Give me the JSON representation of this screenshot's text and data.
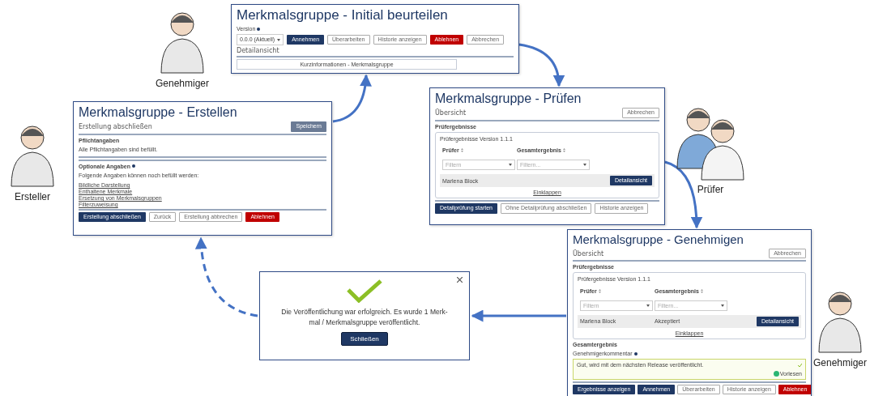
{
  "roles": [
    {
      "kind": "single",
      "label": "Genehmiger"
    },
    {
      "kind": "single",
      "label": "Ersteller"
    },
    {
      "kind": "pair",
      "label": "Prüfer"
    },
    {
      "kind": "single",
      "label": "Genehmiger"
    }
  ],
  "initial_panel": {
    "title": "Merkmalsgruppe - Initial beurteilen",
    "version_label": "Version",
    "version_value": "0.0.0 (Aktuell)",
    "buttons": [
      {
        "label": "Annehmen",
        "kind": "primary"
      },
      {
        "label": "Überarbeiten",
        "kind": "secondary"
      },
      {
        "label": "Historie anzeigen",
        "kind": "secondary"
      },
      {
        "label": "Ablehnen",
        "kind": "danger"
      },
      {
        "label": "Abbrechen",
        "kind": "secondary"
      }
    ],
    "section": "Detailansicht",
    "card_title": "Kurzinformationen - Merkmalsgruppe"
  },
  "create_panel": {
    "title": "Merkmalsgruppe - Erstellen",
    "subtitle": "Erstellung abschließen",
    "save_button": "Speichern",
    "required_heading": "Pflichtangaben",
    "required_text": "Alle Pflichtangaben sind befüllt.",
    "optional_heading": "Optionale Angaben",
    "optional_text": "Folgende Angaben können noch befüllt werden:",
    "links": [
      "Bildliche Darstellung",
      "Enthaltene Merkmale",
      "Ersetzung von Merkmalsgruppen",
      "Filterzuweisung"
    ],
    "buttons": [
      {
        "label": "Erstellung abschließen",
        "kind": "primary"
      },
      {
        "label": "Zurück",
        "kind": "secondary"
      },
      {
        "label": "Erstellung abbrechen",
        "kind": "secondary"
      },
      {
        "label": "Ablehnen",
        "kind": "danger"
      }
    ]
  },
  "review_panel": {
    "title": "Merkmalsgruppe - Prüfen",
    "subtitle": "Übersicht",
    "cancel_button": "Abbrechen",
    "results": {
      "heading": "Prüfergebnisse",
      "version": "Prüfergebnisse Version 1.1.1",
      "columns": [
        "Prüfer",
        "Gesamtergebnis"
      ],
      "filters": [
        "Filtern",
        "Filtern..."
      ],
      "rows": [
        {
          "cells": [
            "Marlena Block",
            ""
          ],
          "button": "Detailansicht"
        }
      ],
      "collapse": "Einklappen"
    },
    "buttons": [
      {
        "label": "Detailprüfung starten",
        "kind": "primary"
      },
      {
        "label": "Ohne Detailprüfung abschließen",
        "kind": "secondary"
      },
      {
        "label": "Historie anzeigen",
        "kind": "secondary"
      }
    ]
  },
  "approve_panel": {
    "title": "Merkmalsgruppe - Genehmigen",
    "subtitle": "Übersicht",
    "cancel_button": "Abbrechen",
    "results": {
      "heading": "Prüfergebnisse",
      "version": "Prüfergebnisse Version 1.1.1",
      "columns": [
        "Prüfer",
        "Gesamtergebnis"
      ],
      "filters": [
        "Filtern",
        "Filtern..."
      ],
      "rows": [
        {
          "cells": [
            "Marlena Block",
            "Akzeptiert"
          ],
          "button": "Detailansicht"
        }
      ],
      "collapse": "Einklappen"
    },
    "overall_heading": "Gesamtergebnis",
    "comment_label": "Genehmigerkommentar",
    "comment_value": "Gut, wird mit dem nächsten Release veröffentlicht.",
    "read_aloud": "Vorlesen",
    "buttons": [
      {
        "label": "Ergebnisse anzeigen",
        "kind": "primary"
      },
      {
        "label": "Annehmen",
        "kind": "primary"
      },
      {
        "label": "Überarbeiten",
        "kind": "secondary"
      },
      {
        "label": "Historie anzeigen",
        "kind": "secondary"
      },
      {
        "label": "Ablehnen",
        "kind": "danger"
      }
    ]
  },
  "success_dialog": {
    "message": "Die Veröffentlichung war erfolgreich. Es wurde 1 Merk-\nmal / Merkmalsgruppe veröffentlicht.",
    "close_button": "Schließen"
  }
}
